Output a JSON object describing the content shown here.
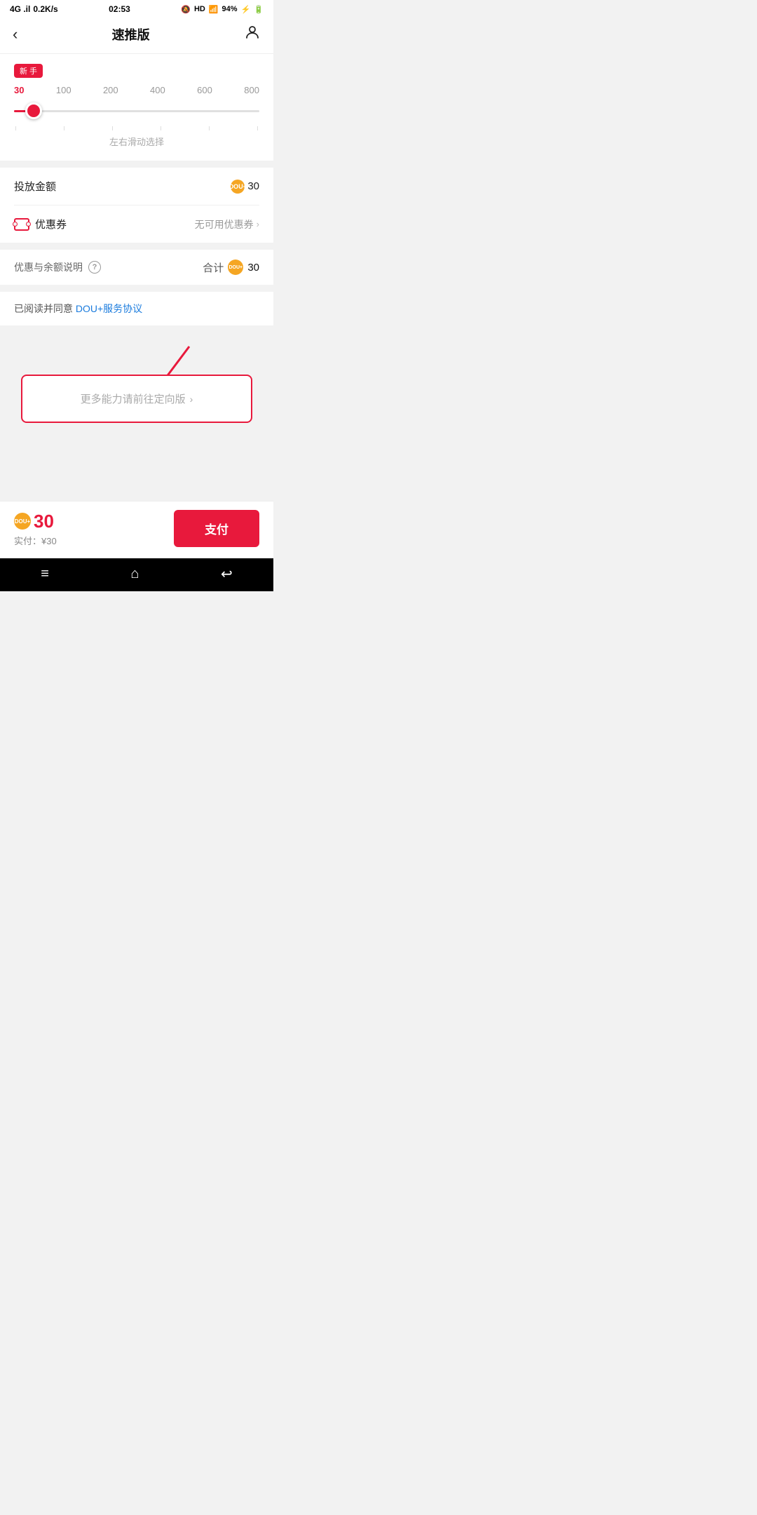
{
  "status": {
    "carrier": "4G",
    "signal": "4G .il",
    "speed": "0.2K/s",
    "time": "02:53",
    "alarm": "🔕",
    "hd": "HD",
    "wifi": "WiFi",
    "battery": "94%"
  },
  "nav": {
    "back": "‹",
    "title": "速推版",
    "profile_icon": "👤"
  },
  "slider": {
    "badge": "新 手",
    "scale_values": [
      "30",
      "100",
      "200",
      "400",
      "600",
      "800"
    ],
    "current_value": "30",
    "hint": "左右滑动选择"
  },
  "amount_row": {
    "label": "投放金额",
    "value": "30"
  },
  "coupon_row": {
    "label": "优惠券",
    "value": "无可用优惠券"
  },
  "subtotal": {
    "label": "优惠与余额说明",
    "total_label": "合计",
    "total_value": "30"
  },
  "agreement": {
    "prefix": "已阅读并同意 ",
    "link_text": "DOU+服务协议"
  },
  "more_options": {
    "text": "更多能力请前往定向版",
    "chevron": "›"
  },
  "bottom": {
    "coin_amount": "30",
    "actual_label": "实付：",
    "actual_price": "¥30",
    "pay_label": "支付"
  }
}
